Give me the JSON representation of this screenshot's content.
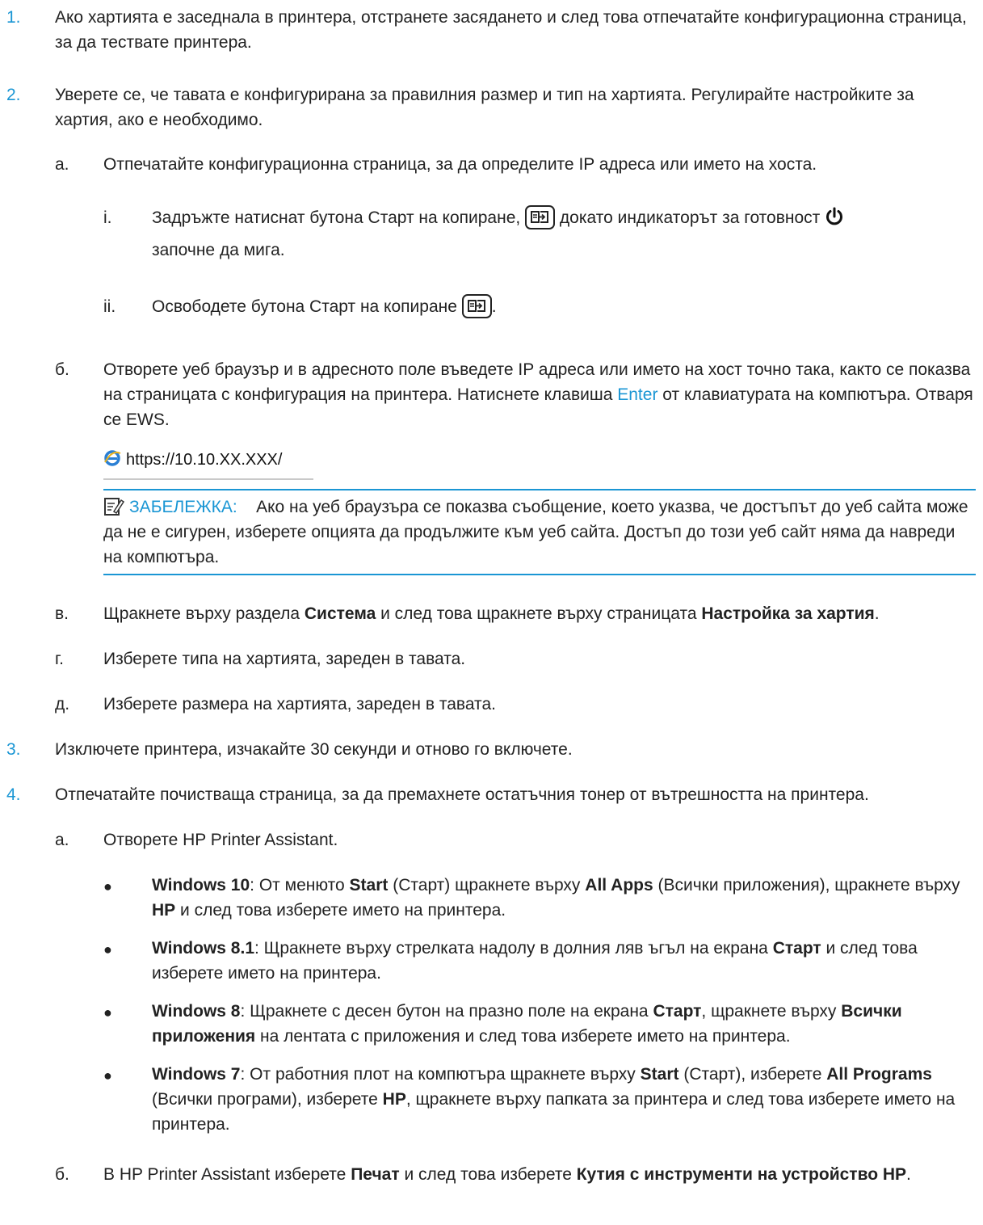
{
  "steps": [
    {
      "num": "1.",
      "text": "Ако хартията е заседнала в принтера, отстранете засядането и след това отпечатайте конфигурационна страница, за да тествате принтера."
    },
    {
      "num": "2.",
      "text": "Уверете се, че тавата е конфигурирана за правилния размер и тип на хартията. Регулирайте настройките за хартия, ако е необходимо."
    },
    {
      "num": "3.",
      "text": "Изключете принтера, изчакайте 30 секунди и отново го включете."
    },
    {
      "num": "4.",
      "text": "Отпечатайте почистваща страница, за да премахнете остатъчния тонер от вътрешността на принтера."
    }
  ],
  "step2": {
    "a_label": "а.",
    "a_text": "Отпечатайте конфигурационна страница, за да определите IP адреса или името на хоста.",
    "i_label": "i.",
    "i_text_1": "Задръжте натиснат бутона Старт на копиране,",
    "i_text_2": "докато индикаторът за готовност",
    "i_text_3": "започне да мига.",
    "ii_label": "ii.",
    "ii_text": "Освободете бутона Старт на копиране",
    "ii_end": ".",
    "b_label": "б.",
    "b_text_1": "Отворете уеб браузър и в адресното поле въведете IP адреса или името на хост точно така, както се показва на страницата с конфигурация на принтера. Натиснете клавиша",
    "b_link": "Enter",
    "b_text_2": "от клавиатурата на компютъра. Отваря се EWS.",
    "url": "https://10.10.XX.XXX/",
    "note_label": "ЗАБЕЛЕЖКА:",
    "note_text": "Ако на уеб браузъра се показва съобщение, което указва, че достъпът до уеб сайта може да не е сигурен, изберете опцията да продължите към уеб сайта. Достъп до този уеб сайт няма да навреди на компютъра.",
    "v_label": "в.",
    "v_text_1": "Щракнете върху раздела",
    "v_bold_1": "Система",
    "v_text_2": "и след това щракнете върху страницата",
    "v_bold_2": "Настройка за хартия",
    "v_end": ".",
    "g_label": "г.",
    "g_text": "Изберете типа на хартията, зареден в тавата.",
    "d_label": "д.",
    "d_text": "Изберете размера на хартията, зареден в тавата."
  },
  "step4": {
    "a_label": "а.",
    "a_text": "Отворете HP Printer Assistant.",
    "bullets": [
      {
        "os": "Windows 10",
        "parts": [
          ": От менюто ",
          "Start",
          " (Старт) щракнете върху ",
          "All Apps",
          " (Всички приложения), щракнете върху ",
          "HP",
          " и след това изберете името на принтера."
        ]
      },
      {
        "os": "Windows 8.1",
        "parts": [
          ": Щракнете върху стрелката надолу в долния ляв ъгъл на екрана ",
          "Старт",
          " и след това изберете името на принтера."
        ]
      },
      {
        "os": "Windows 8",
        "parts": [
          ": Щракнете с десен бутон на празно поле на екрана ",
          "Старт",
          ", щракнете върху ",
          "Всички приложения",
          " на лентата с приложения и след това изберете името на принтера."
        ]
      },
      {
        "os": "Windows 7",
        "parts": [
          ": От работния плот на компютъра щракнете върху ",
          "Start",
          " (Старт), изберете ",
          "All Programs",
          " (Всички програми), изберете ",
          "HP",
          ", щракнете върху папката за принтера и след това изберете името на принтера."
        ]
      }
    ],
    "b_label": "б.",
    "b_text_1": "В HP Printer Assistant изберете",
    "b_bold_1": "Печат",
    "b_text_2": "и след това изберете",
    "b_bold_2": "Кутия с инструменти на устройство HP",
    "b_end": "."
  }
}
